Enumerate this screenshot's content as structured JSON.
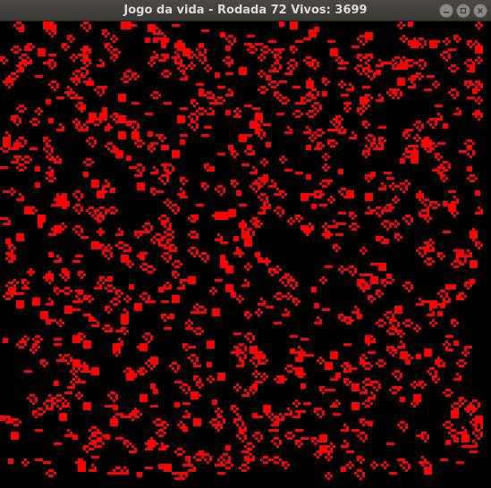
{
  "window": {
    "title": "Jogo da vida - Rodada 72 Vivos: 3699",
    "buttons": [
      "minimize",
      "maximize",
      "close"
    ]
  },
  "game": {
    "name": "Jogo da vida",
    "round": 72,
    "alive_count": 3699,
    "cell_color": "#ff0000",
    "background_color": "#000000"
  }
}
